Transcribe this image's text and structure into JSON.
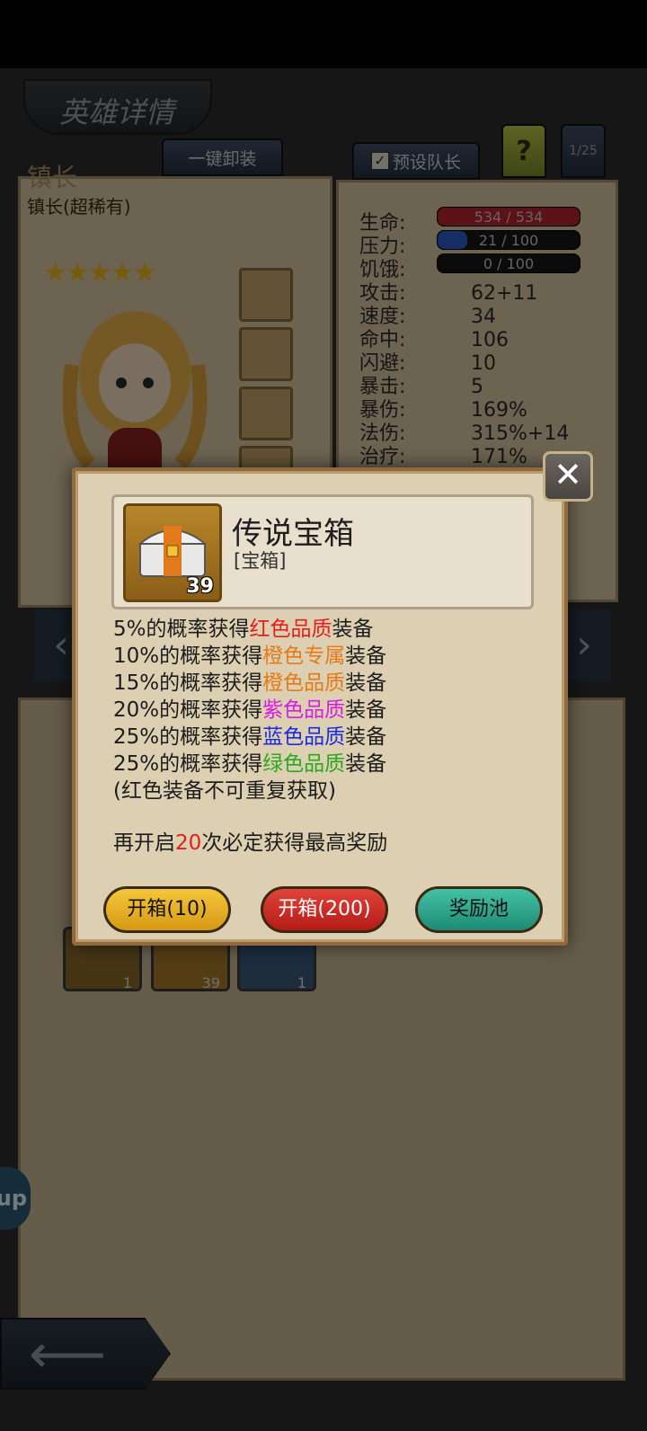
{
  "header": {
    "title": "英雄详情"
  },
  "buttons": {
    "unequip_all": "一键卸装",
    "preset_leader": "预设队长",
    "help": "?",
    "page_indicator": "1/25"
  },
  "hero": {
    "name": "镇长",
    "subtitle": "镇长(超稀有)",
    "stars": "★★★★★",
    "star_count": 5
  },
  "stats": [
    {
      "label": "生命:",
      "value": "534 / 534",
      "bar": true,
      "fill": 1.0,
      "color": "#b8242c"
    },
    {
      "label": "压力:",
      "value": "21 / 100",
      "bar": true,
      "fill": 0.21,
      "color": "#2a5cc8"
    },
    {
      "label": "饥饿:",
      "value": "0 / 100",
      "bar": true,
      "fill": 0.0,
      "color": "#c8a020"
    },
    {
      "label": "攻击:",
      "value": "62+11"
    },
    {
      "label": "速度:",
      "value": "34"
    },
    {
      "label": "命中:",
      "value": "106"
    },
    {
      "label": "闪避:",
      "value": "10"
    },
    {
      "label": "暴击:",
      "value": "5"
    },
    {
      "label": "暴伤:",
      "value": "169%"
    },
    {
      "label": "法伤:",
      "value": "315%+14"
    },
    {
      "label": "治疗:",
      "value": "171%"
    }
  ],
  "inventory_counts": [
    "1",
    "39",
    "1"
  ],
  "side_bubble": "up",
  "modal": {
    "item_name": "传说宝箱",
    "item_type": "[宝箱]",
    "item_count": "39",
    "drop_lines": [
      {
        "prefix": "5%的概率获得",
        "highlight": "红色品质",
        "suffix": "装备",
        "color": "red"
      },
      {
        "prefix": "10%的概率获得",
        "highlight": "橙色专属",
        "suffix": "装备",
        "color": "orange"
      },
      {
        "prefix": "15%的概率获得",
        "highlight": "橙色品质",
        "suffix": "装备",
        "color": "orange"
      },
      {
        "prefix": "20%的概率获得",
        "highlight": "紫色品质",
        "suffix": "装备",
        "color": "purple"
      },
      {
        "prefix": "25%的概率获得",
        "highlight": "蓝色品质",
        "suffix": "装备",
        "color": "blue"
      },
      {
        "prefix": "25%的概率获得",
        "highlight": "绿色品质",
        "suffix": "装备",
        "color": "green"
      }
    ],
    "note": "(红色装备不可重复获取)",
    "guarantee_prefix": "再开启",
    "guarantee_count": "20",
    "guarantee_suffix": "次必定获得最高奖励",
    "btn_open_10": "开箱(10)",
    "btn_open_200": "开箱(200)",
    "btn_reward_pool": "奖励池"
  }
}
